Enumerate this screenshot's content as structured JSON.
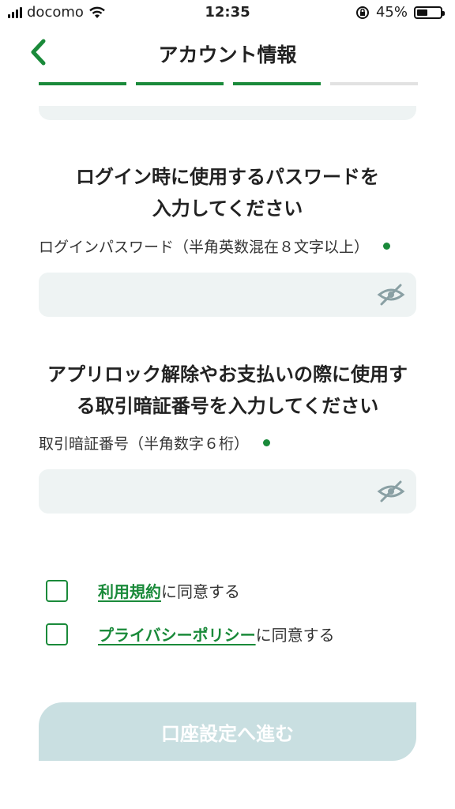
{
  "status_bar": {
    "carrier": "docomo",
    "time": "12:35",
    "battery": "45%"
  },
  "nav": {
    "title": "アカウント情報",
    "back_icon": "chevron-left-icon"
  },
  "progress": {
    "steps_total": 4,
    "steps_done": 3,
    "color": "#1a8a3a"
  },
  "password_section": {
    "heading_line1": "ログイン時に使用するパスワードを",
    "heading_line2": "入力してください",
    "label": "ログインパスワード（半角英数混在８文字以上）",
    "value": "",
    "toggle_icon": "eye-off-icon"
  },
  "pin_section": {
    "heading_line1": "アプリロック解除やお支払いの際に使用す",
    "heading_line2": "る取引暗証番号を入力してください",
    "label": "取引暗証番号（半角数字６桁）",
    "value": "",
    "toggle_icon": "eye-off-icon"
  },
  "agreements": [
    {
      "link": "利用規約",
      "suffix": "に同意する",
      "checked": false
    },
    {
      "link": "プライバシーポリシー",
      "suffix": "に同意する",
      "checked": false
    }
  ],
  "submit_label": "口座設定へ進む",
  "colors": {
    "accent": "#1a8a3a",
    "field_bg": "#eef3f3",
    "button_disabled": "#c9dfe1"
  }
}
